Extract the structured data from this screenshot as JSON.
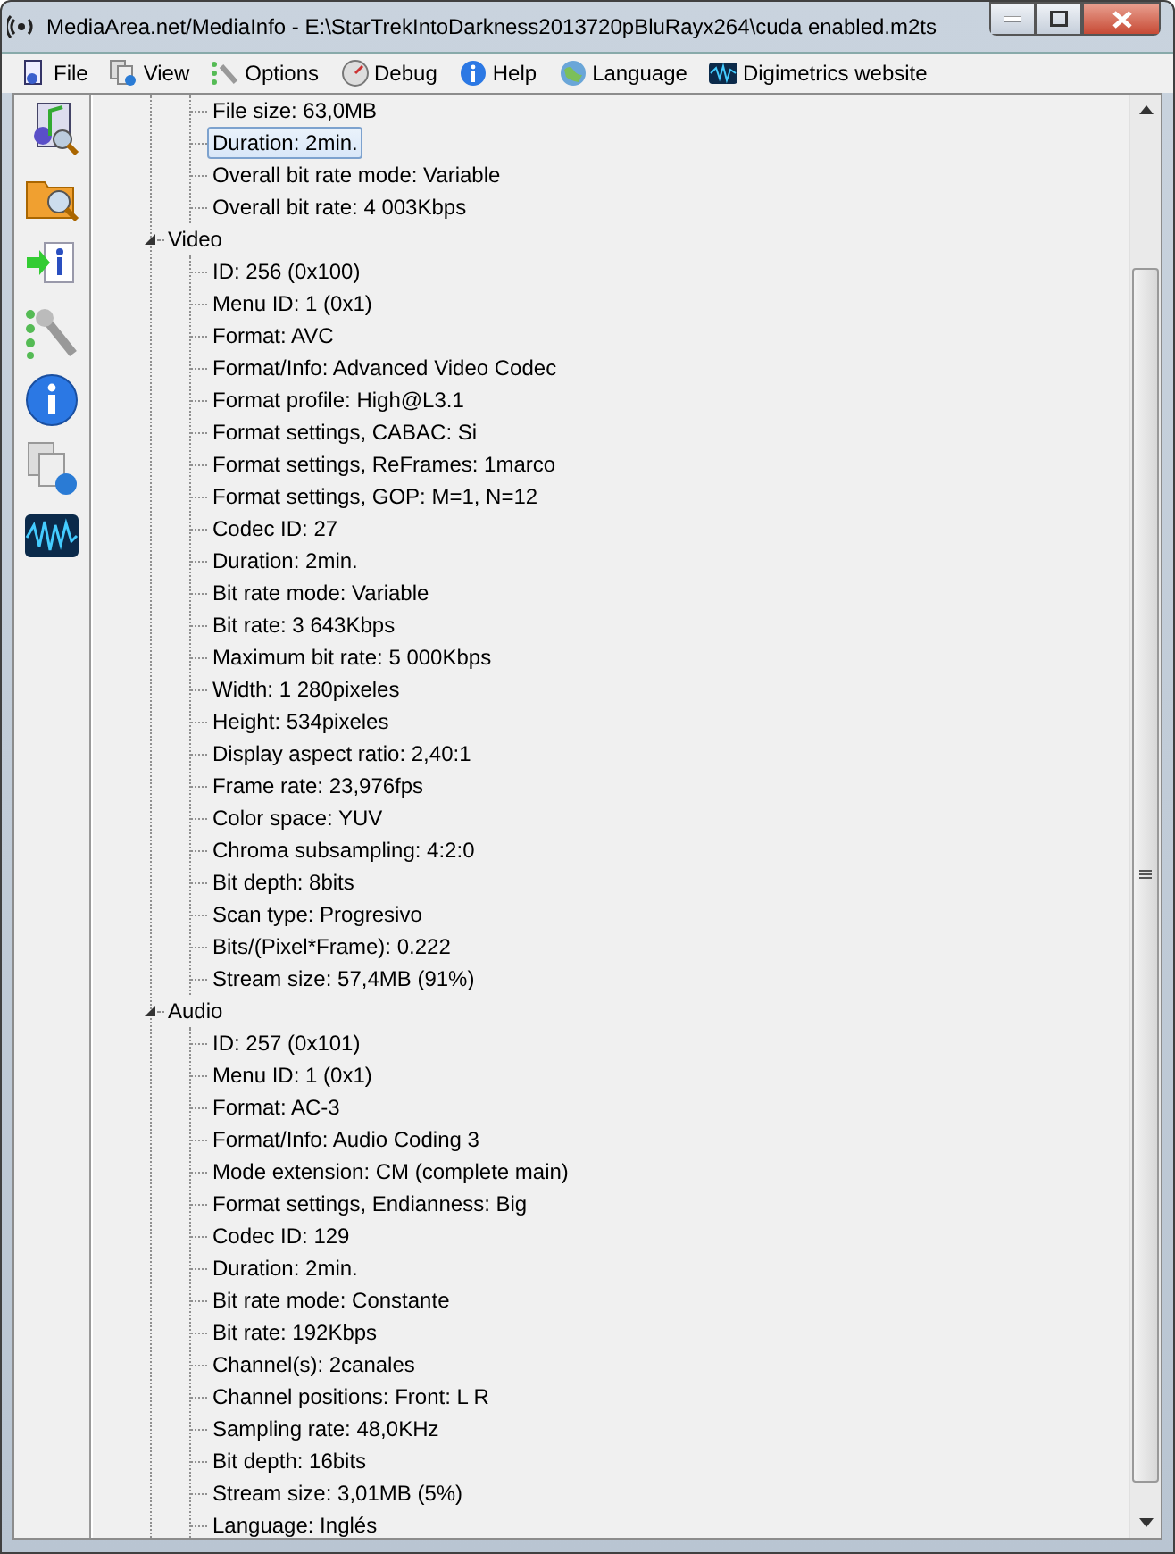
{
  "window": {
    "title": "MediaArea.net/MediaInfo - E:\\StarTrekIntoDarkness2013720pBluRayx264\\cuda enabled.m2ts"
  },
  "menu": [
    {
      "label": "File",
      "kind": "file"
    },
    {
      "label": "View",
      "kind": "view"
    },
    {
      "label": "Options",
      "kind": "options"
    },
    {
      "label": "Debug",
      "kind": "debug"
    },
    {
      "label": "Help",
      "kind": "help"
    },
    {
      "label": "Language",
      "kind": "language"
    },
    {
      "label": "Digimetrics website",
      "kind": "web"
    }
  ],
  "toolbar": [
    {
      "kind": "audio-file"
    },
    {
      "kind": "folder"
    },
    {
      "kind": "export"
    },
    {
      "kind": "tools"
    },
    {
      "kind": "info"
    },
    {
      "kind": "docs"
    },
    {
      "kind": "wave"
    }
  ],
  "tree": [
    {
      "items": [
        {
          "text": "File size: 63,0MB",
          "selected": false
        },
        {
          "text": "Duration: 2min.",
          "selected": true
        },
        {
          "text": "Overall bit rate mode: Variable",
          "selected": false
        },
        {
          "text": "Overall bit rate: 4 003Kbps",
          "selected": false
        }
      ]
    },
    {
      "title": "Video",
      "expanded": true,
      "items": [
        {
          "text": "ID: 256 (0x100)",
          "selected": false
        },
        {
          "text": "Menu ID: 1 (0x1)",
          "selected": false
        },
        {
          "text": "Format: AVC",
          "selected": false
        },
        {
          "text": "Format/Info: Advanced Video Codec",
          "selected": false
        },
        {
          "text": "Format profile: High@L3.1",
          "selected": false
        },
        {
          "text": "Format settings, CABAC: Si",
          "selected": false
        },
        {
          "text": "Format settings, ReFrames: 1marco",
          "selected": false
        },
        {
          "text": "Format settings, GOP: M=1, N=12",
          "selected": false
        },
        {
          "text": "Codec ID: 27",
          "selected": false
        },
        {
          "text": "Duration: 2min.",
          "selected": false
        },
        {
          "text": "Bit rate mode: Variable",
          "selected": false
        },
        {
          "text": "Bit rate: 3 643Kbps",
          "selected": false
        },
        {
          "text": "Maximum bit rate: 5 000Kbps",
          "selected": false
        },
        {
          "text": "Width: 1 280pixeles",
          "selected": false
        },
        {
          "text": "Height: 534pixeles",
          "selected": false
        },
        {
          "text": "Display aspect ratio: 2,40:1",
          "selected": false
        },
        {
          "text": "Frame rate: 23,976fps",
          "selected": false
        },
        {
          "text": "Color space: YUV",
          "selected": false
        },
        {
          "text": "Chroma subsampling: 4:2:0",
          "selected": false
        },
        {
          "text": "Bit depth: 8bits",
          "selected": false
        },
        {
          "text": "Scan type: Progresivo",
          "selected": false
        },
        {
          "text": "Bits/(Pixel*Frame): 0.222",
          "selected": false
        },
        {
          "text": "Stream size: 57,4MB (91%)",
          "selected": false
        }
      ]
    },
    {
      "title": "Audio",
      "expanded": true,
      "items": [
        {
          "text": "ID: 257 (0x101)",
          "selected": false
        },
        {
          "text": "Menu ID: 1 (0x1)",
          "selected": false
        },
        {
          "text": "Format: AC-3",
          "selected": false
        },
        {
          "text": "Format/Info: Audio Coding 3",
          "selected": false
        },
        {
          "text": "Mode extension: CM (complete main)",
          "selected": false
        },
        {
          "text": "Format settings, Endianness: Big",
          "selected": false
        },
        {
          "text": "Codec ID: 129",
          "selected": false
        },
        {
          "text": "Duration: 2min.",
          "selected": false
        },
        {
          "text": "Bit rate mode: Constante",
          "selected": false
        },
        {
          "text": "Bit rate: 192Kbps",
          "selected": false
        },
        {
          "text": "Channel(s): 2canales",
          "selected": false
        },
        {
          "text": "Channel positions: Front: L R",
          "selected": false
        },
        {
          "text": "Sampling rate: 48,0KHz",
          "selected": false
        },
        {
          "text": "Bit depth: 16bits",
          "selected": false
        },
        {
          "text": "Stream size: 3,01MB (5%)",
          "selected": false
        },
        {
          "text": "Language: Inglés",
          "selected": false
        }
      ]
    }
  ]
}
